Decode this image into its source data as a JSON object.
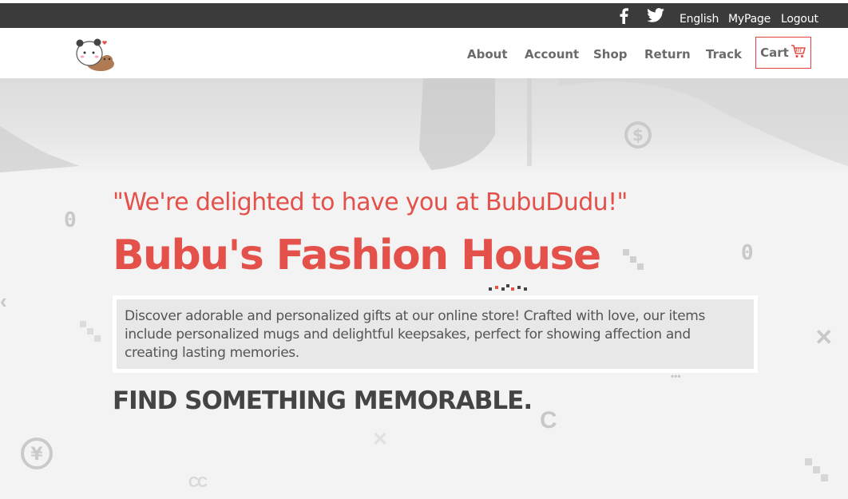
{
  "topbar": {
    "social_icons": [
      "facebook-icon",
      "twitter-icon"
    ],
    "language": "English",
    "mypage": "MyPage",
    "logout": "Logout"
  },
  "nav": {
    "logo_icon": "panda-bear-logo",
    "items": [
      "About",
      "Account",
      "Shop",
      "Return",
      "Track"
    ],
    "cart_label": "Cart",
    "cart_icon": "shopping-cart-icon"
  },
  "hero": {
    "quote": "\"We're delighted to have you at BubuDudu!\"",
    "title": "Bubu's Fashion House",
    "description": "Discover adorable and personalized gifts at our online store! Crafted with love, our items include personalized mugs and delightful keepsakes, perfect for showing affection and creating lasting memories.",
    "subheading": "FIND SOMETHING MEMORABLE."
  },
  "colors": {
    "accent": "#e4504a",
    "topbar_bg": "#3b3b3b",
    "nav_text": "#6a6a6a",
    "hero_bg": "#f3f3f3"
  }
}
